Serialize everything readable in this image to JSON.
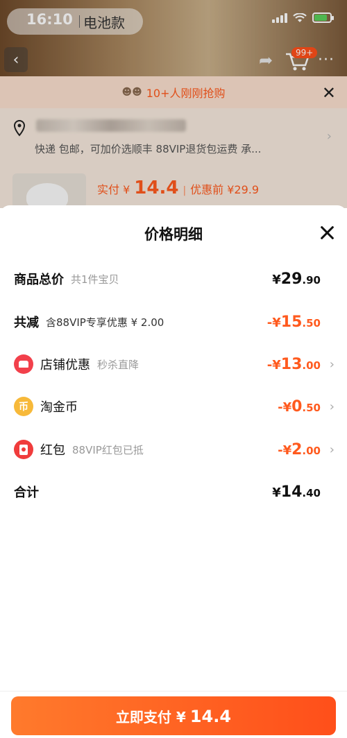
{
  "status": {
    "time": "16:10"
  },
  "search": {
    "tag": "电池款"
  },
  "cart": {
    "badge": "99+"
  },
  "banner": {
    "text": "10+人刚刚抢购"
  },
  "delivery": {
    "text": "快递 包邮，可加价选顺丰 88VIP退货包运费 承..."
  },
  "product": {
    "real_pay_label": "实付 ¥",
    "real_pay_amount": "14.4",
    "before_label": "优惠前 ¥29.9"
  },
  "sheet": {
    "title": "价格明细",
    "rows": [
      {
        "name": "商品总价",
        "note": "共1件宝贝",
        "price_sym": "¥",
        "price_int": "29",
        "price_dec": ".90"
      },
      {
        "name": "共减",
        "note": "含88VIP专享优惠 ¥ 2.00",
        "price_sym": "-¥",
        "price_int": "15",
        "price_dec": ".50"
      },
      {
        "name": "店铺优惠",
        "note": "秒杀直降",
        "price_sym": "-¥",
        "price_int": "13",
        "price_dec": ".00",
        "icon": "shop-icon"
      },
      {
        "name": "淘金币",
        "note": "",
        "price_sym": "-¥",
        "price_int": "0",
        "price_dec": ".50",
        "icon": "coin-icon"
      },
      {
        "name": "红包",
        "note": "88VIP红包已抵",
        "price_sym": "-¥",
        "price_int": "2",
        "price_dec": ".00",
        "icon": "red-packet-icon"
      },
      {
        "name": "合计",
        "note": "",
        "price_sym": "¥",
        "price_int": "14",
        "price_dec": ".40"
      }
    ],
    "coin_glyph": "币"
  },
  "pay_button": {
    "label": "立即支付 ¥",
    "amount": "14.4"
  },
  "colors": {
    "accent": "#ff5a1e",
    "button_start": "#ff7a2c",
    "button_end": "#ff4f1a"
  }
}
